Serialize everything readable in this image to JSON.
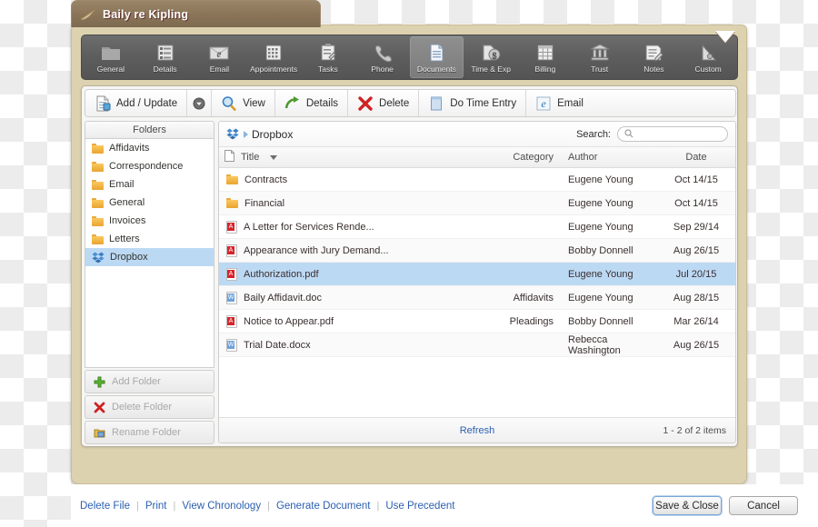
{
  "window": {
    "title": "Baily re Kipling",
    "title_icon": "feather-icon",
    "collapse_icon": "triangle-down-icon"
  },
  "ribbon": {
    "items": [
      {
        "label": "General",
        "icon": "folder-icon",
        "active": false
      },
      {
        "label": "Details",
        "icon": "list-icon",
        "active": false
      },
      {
        "label": "Email",
        "icon": "envelope-e-icon",
        "active": false
      },
      {
        "label": "Appointments",
        "icon": "calendar-icon",
        "active": false
      },
      {
        "label": "Tasks",
        "icon": "clipboard-icon",
        "active": false
      },
      {
        "label": "Phone",
        "icon": "phone-icon",
        "active": false
      },
      {
        "label": "Documents",
        "icon": "document-icon",
        "active": true
      },
      {
        "label": "Time & Exp",
        "icon": "coin-icon",
        "active": false
      },
      {
        "label": "Billing",
        "icon": "grid-icon",
        "active": false
      },
      {
        "label": "Trust",
        "icon": "bank-icon",
        "active": false
      },
      {
        "label": "Notes",
        "icon": "note-pencil-icon",
        "active": false
      },
      {
        "label": "Custom",
        "icon": "triangle-icon",
        "active": false
      }
    ]
  },
  "actionbar": {
    "items": [
      {
        "label": "Add / Update",
        "icon": "document-add-icon"
      },
      {
        "label": "View",
        "icon": "magnifier-icon"
      },
      {
        "label": "Details",
        "icon": "green-arrow-icon"
      },
      {
        "label": "Delete",
        "icon": "red-x-icon"
      },
      {
        "label": "Do Time Entry",
        "icon": "blue-page-icon"
      },
      {
        "label": "Email",
        "icon": "blue-e-icon"
      }
    ],
    "dropdown_icon": "chevron-down-circle-icon"
  },
  "folders": {
    "header": "Folders",
    "items": [
      {
        "label": "Affidavits",
        "icon": "folder-icon",
        "selected": false
      },
      {
        "label": "Correspondence",
        "icon": "folder-icon",
        "selected": false
      },
      {
        "label": "Email",
        "icon": "folder-icon",
        "selected": false
      },
      {
        "label": "General",
        "icon": "folder-icon",
        "selected": false
      },
      {
        "label": "Invoices",
        "icon": "folder-icon",
        "selected": false
      },
      {
        "label": "Letters",
        "icon": "folder-icon",
        "selected": false
      },
      {
        "label": "Dropbox",
        "icon": "dropbox-icon",
        "selected": true
      }
    ],
    "buttons": [
      {
        "label": "Add Folder",
        "icon": "green-plus-icon"
      },
      {
        "label": "Delete Folder",
        "icon": "red-x-icon"
      },
      {
        "label": "Rename Folder",
        "icon": "rename-icon"
      }
    ]
  },
  "breadcrumb": {
    "icon": "dropbox-icon",
    "separator_icon": "arrow-right-icon",
    "label": "Dropbox"
  },
  "search": {
    "label": "Search:",
    "placeholder": "",
    "value": "",
    "icon": "magnifier-icon"
  },
  "table": {
    "columns": {
      "title": "Title",
      "category": "Category",
      "author": "Author",
      "date": "Date"
    },
    "sort_indicator": "sort-desc-icon",
    "header_icon": "page-icon",
    "rows": [
      {
        "icon": "folder-icon",
        "title": "Contracts",
        "category": "",
        "author": "Eugene Young",
        "date": "Oct 14/15",
        "selected": false
      },
      {
        "icon": "folder-icon",
        "title": "Financial",
        "category": "",
        "author": "Eugene Young",
        "date": "Oct 14/15",
        "selected": false
      },
      {
        "icon": "pdf-icon",
        "title": "A Letter for Services Rende...",
        "category": "",
        "author": "Eugene Young",
        "date": "Sep 29/14",
        "selected": false
      },
      {
        "icon": "pdf-icon",
        "title": "Appearance with Jury Demand...",
        "category": "",
        "author": "Bobby Donnell",
        "date": "Aug 26/15",
        "selected": false
      },
      {
        "icon": "pdf-icon",
        "title": "Authorization.pdf",
        "category": "",
        "author": "Eugene Young",
        "date": "Jul 20/15",
        "selected": true
      },
      {
        "icon": "doc-icon",
        "title": "Baily Affidavit.doc",
        "category": "Affidavits",
        "author": "Eugene Young",
        "date": "Aug 28/15",
        "selected": false
      },
      {
        "icon": "pdf-icon",
        "title": "Notice to Appear.pdf",
        "category": "Pleadings",
        "author": "Bobby Donnell",
        "date": "Mar 26/14",
        "selected": false
      },
      {
        "icon": "doc-icon",
        "title": "Trial Date.docx",
        "category": "",
        "author": "Rebecca Washington",
        "date": "Aug 26/15",
        "selected": false
      }
    ],
    "footer": {
      "refresh": "Refresh",
      "count": "1 - 2 of 2 items"
    }
  },
  "bottombar": {
    "links": [
      "Delete File",
      "Print",
      "View Chronology",
      "Generate Document",
      "Use Precedent"
    ],
    "save_label": "Save & Close",
    "cancel_label": "Cancel"
  },
  "colors": {
    "window_frame": "#ddd2b0",
    "title_bar": "#8a7458",
    "ribbon": "#5d5d5d",
    "selection": "#bcd9f4",
    "link": "#2c5fb0"
  }
}
